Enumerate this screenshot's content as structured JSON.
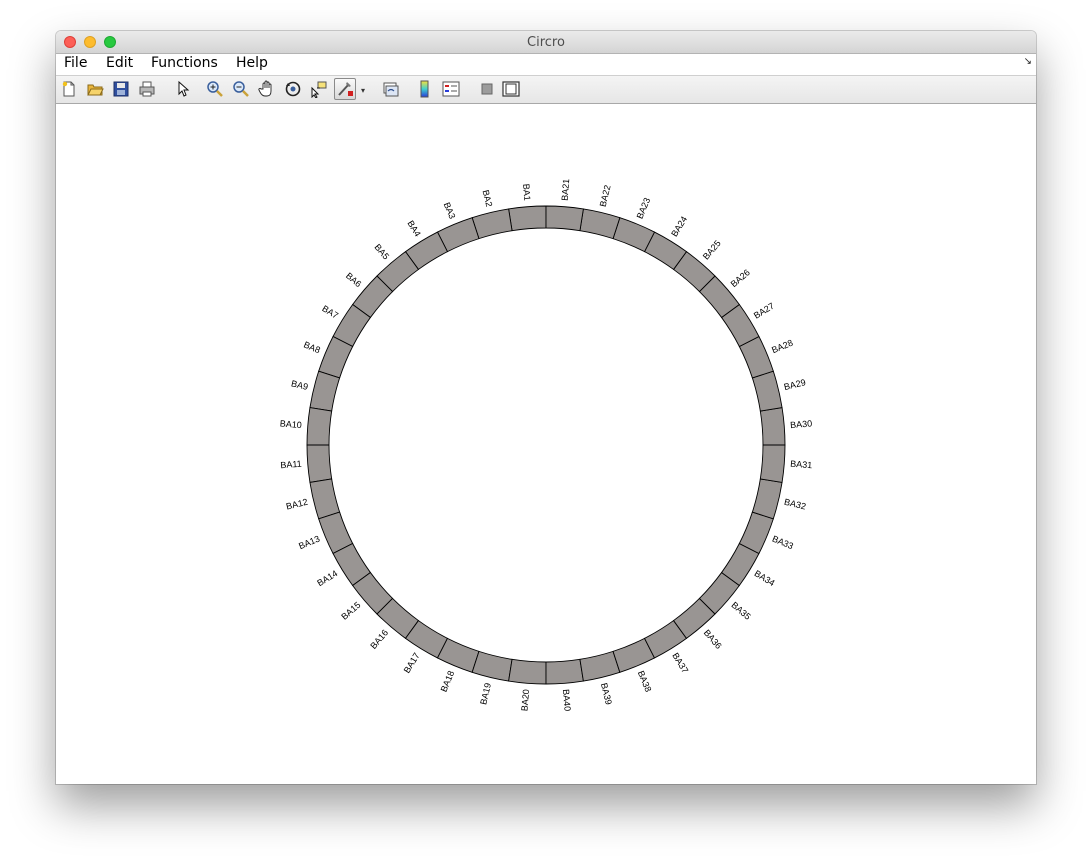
{
  "window": {
    "title": "Circro"
  },
  "menu": {
    "items": [
      {
        "label": "File"
      },
      {
        "label": "Edit"
      },
      {
        "label": "Functions"
      },
      {
        "label": "Help"
      }
    ]
  },
  "toolbar": {
    "buttons": [
      {
        "name": "new-figure-button",
        "icon": "new-document-icon"
      },
      {
        "name": "open-file-button",
        "icon": "folder-open-icon"
      },
      {
        "name": "save-button",
        "icon": "floppy-disk-icon"
      },
      {
        "name": "print-button",
        "icon": "printer-icon"
      },
      {
        "name": "edit-plot-button",
        "icon": "arrow-pointer-icon"
      },
      {
        "name": "zoom-in-button",
        "icon": "zoom-in-icon"
      },
      {
        "name": "zoom-out-button",
        "icon": "zoom-out-icon"
      },
      {
        "name": "pan-button",
        "icon": "hand-icon"
      },
      {
        "name": "rotate-3d-button",
        "icon": "rotate-icon"
      },
      {
        "name": "data-cursor-button",
        "icon": "data-cursor-icon"
      },
      {
        "name": "brush-button",
        "icon": "brush-icon"
      },
      {
        "name": "link-plot-button",
        "icon": "link-plot-icon"
      },
      {
        "name": "colorbar-button",
        "icon": "colorbar-icon"
      },
      {
        "name": "legend-button",
        "icon": "legend-icon"
      },
      {
        "name": "hide-plot-tools-button",
        "icon": "hide-tools-icon"
      },
      {
        "name": "show-plot-tools-button",
        "icon": "show-tools-icon"
      }
    ]
  },
  "diagram": {
    "segment_color": "#999593",
    "segment_stroke": "#000000",
    "labels": [
      "BA1",
      "BA2",
      "BA3",
      "BA4",
      "BA5",
      "BA6",
      "BA7",
      "BA8",
      "BA9",
      "BA10",
      "BA11",
      "BA12",
      "BA13",
      "BA14",
      "BA15",
      "BA16",
      "BA17",
      "BA18",
      "BA19",
      "BA20",
      "BA40",
      "BA39",
      "BA38",
      "BA37",
      "BA36",
      "BA35",
      "BA34",
      "BA33",
      "BA32",
      "BA31",
      "BA30",
      "BA29",
      "BA28",
      "BA27",
      "BA26",
      "BA25",
      "BA24",
      "BA23",
      "BA22",
      "BA21"
    ]
  }
}
